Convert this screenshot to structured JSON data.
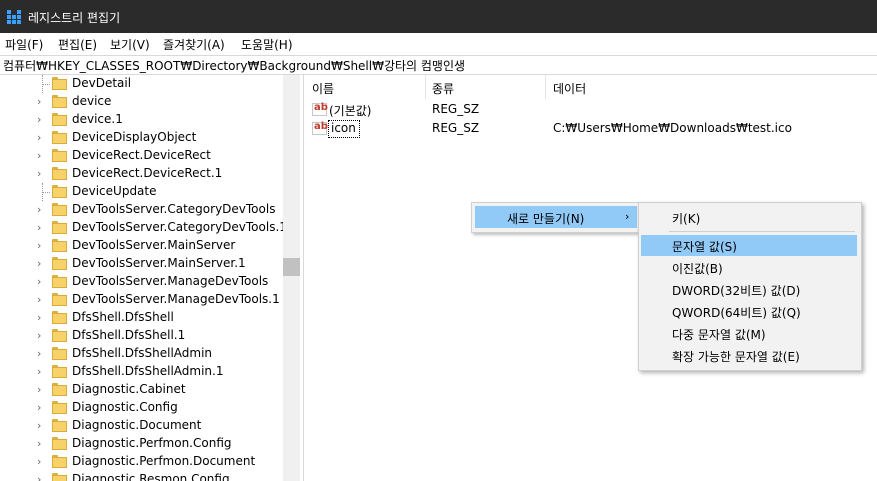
{
  "window": {
    "title": "레지스트리 편집기",
    "icon": "registry-icon"
  },
  "menu": [
    "파일(F)",
    "편집(E)",
    "보기(V)",
    "즐겨찾기(A)",
    "도움말(H)"
  ],
  "address": "컴퓨터₩HKEY_CLASSES_ROOT₩Directory₩Background₩Shell₩강타의 컴맹인생",
  "tree": [
    {
      "label": "DevDetail",
      "expandable": false
    },
    {
      "label": "device",
      "expandable": true
    },
    {
      "label": "device.1",
      "expandable": true
    },
    {
      "label": "DeviceDisplayObject",
      "expandable": true
    },
    {
      "label": "DeviceRect.DeviceRect",
      "expandable": true
    },
    {
      "label": "DeviceRect.DeviceRect.1",
      "expandable": true
    },
    {
      "label": "DeviceUpdate",
      "expandable": false
    },
    {
      "label": "DevToolsServer.CategoryDevTools",
      "expandable": true
    },
    {
      "label": "DevToolsServer.CategoryDevTools.1",
      "expandable": true
    },
    {
      "label": "DevToolsServer.MainServer",
      "expandable": true
    },
    {
      "label": "DevToolsServer.MainServer.1",
      "expandable": true
    },
    {
      "label": "DevToolsServer.ManageDevTools",
      "expandable": true
    },
    {
      "label": "DevToolsServer.ManageDevTools.1",
      "expandable": true
    },
    {
      "label": "DfsShell.DfsShell",
      "expandable": true
    },
    {
      "label": "DfsShell.DfsShell.1",
      "expandable": true
    },
    {
      "label": "DfsShell.DfsShellAdmin",
      "expandable": true
    },
    {
      "label": "DfsShell.DfsShellAdmin.1",
      "expandable": true
    },
    {
      "label": "Diagnostic.Cabinet",
      "expandable": true
    },
    {
      "label": "Diagnostic.Config",
      "expandable": true
    },
    {
      "label": "Diagnostic.Document",
      "expandable": true
    },
    {
      "label": "Diagnostic.Perfmon.Config",
      "expandable": true
    },
    {
      "label": "Diagnostic.Perfmon.Document",
      "expandable": true
    },
    {
      "label": "Diagnostic.Resmon.Config",
      "expandable": true
    }
  ],
  "list": {
    "columns": [
      "이름",
      "종류",
      "데이터"
    ],
    "rows": [
      {
        "name": "(기본값)",
        "type": "REG_SZ",
        "data": "",
        "icon": "ab-string-icon"
      },
      {
        "name": "icon",
        "type": "REG_SZ",
        "data": "C:₩Users₩Home₩Downloads₩test.ico",
        "icon": "ab-string-icon"
      }
    ]
  },
  "context_menu": {
    "new_label": "새로 만들기(N)",
    "arrow": "›"
  },
  "submenu": [
    "키(K)",
    "문자열 값(S)",
    "이진값(B)",
    "DWORD(32비트) 값(D)",
    "QWORD(64비트) 값(Q)",
    "다중 문자열 값(M)",
    "확장 가능한 문자열 값(E)"
  ],
  "colors": {
    "titlebar": "#2b2b2b",
    "highlight": "#91c9f7",
    "folder": "#f6d269"
  }
}
